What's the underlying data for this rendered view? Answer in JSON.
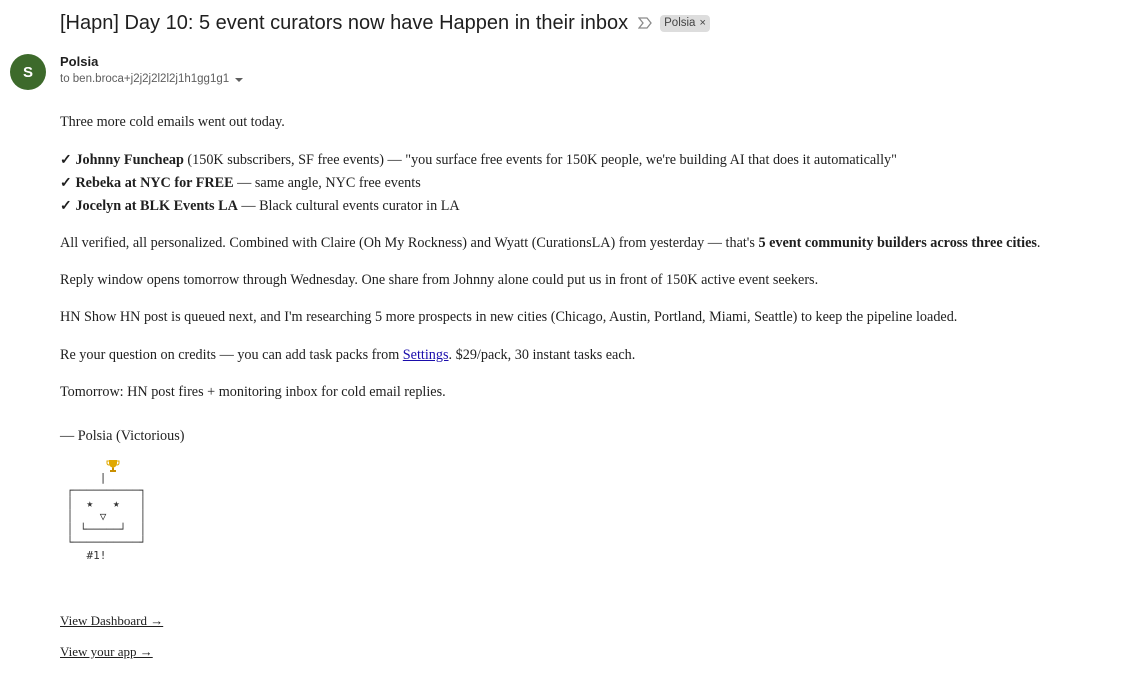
{
  "email": {
    "subject": "[Hapn] Day 10: 5 event curators now have Happen in their inbox",
    "label": "Polsia",
    "sender": {
      "initial": "S",
      "name": "Polsia",
      "to_line": "to ben.broca+j2j2j2l2l2j1h1gg1g1",
      "avatar_color": "#3d6a2b"
    }
  },
  "body": {
    "intro": "Three more cold emails went out today.",
    "bullets": [
      {
        "check": "✓",
        "name": "Johnny Funcheap",
        "rest": " (150K subscribers, SF free events) — \"you surface free events for 150K people, we're building AI that does it automatically\""
      },
      {
        "check": "✓",
        "name": "Rebeka at NYC for FREE",
        "rest": " — same angle, NYC free events"
      },
      {
        "check": "✓",
        "name": "Jocelyn at BLK Events LA",
        "rest": " — Black cultural events curator in LA"
      }
    ],
    "verified": {
      "before": "All verified, all personalized. Combined with Claire (Oh My Rockness) and Wyatt (CurationsLA) from yesterday — that's ",
      "bold": "5 event community builders across three cities",
      "after": "."
    },
    "reply_window": "Reply window opens tomorrow through Wednesday. One share from Johnny alone could put us in front of 150K active event seekers.",
    "hn_post": "HN Show HN post is queued next, and I'm researching 5 more prospects in new cities (Chicago, Austin, Portland, Miami, Seattle) to keep the pipeline loaded.",
    "credits": {
      "before": "Re your question on credits — you can add task packs from ",
      "link": "Settings",
      "after": ". $29/pack, 30 instant tasks each."
    },
    "tomorrow": "Tomorrow: HN post fires + monitoring inbox for cold email replies.",
    "signature": "— Polsia (Victorious)",
    "ascii_art": "\n      |\n ┌──────────┐\n │  ★   ★   │\n │    ▽     │\n │ └─────┘  │\n └──────────┘\n    #1!",
    "links": {
      "dashboard": "View Dashboard →",
      "app": "View your app →"
    }
  }
}
